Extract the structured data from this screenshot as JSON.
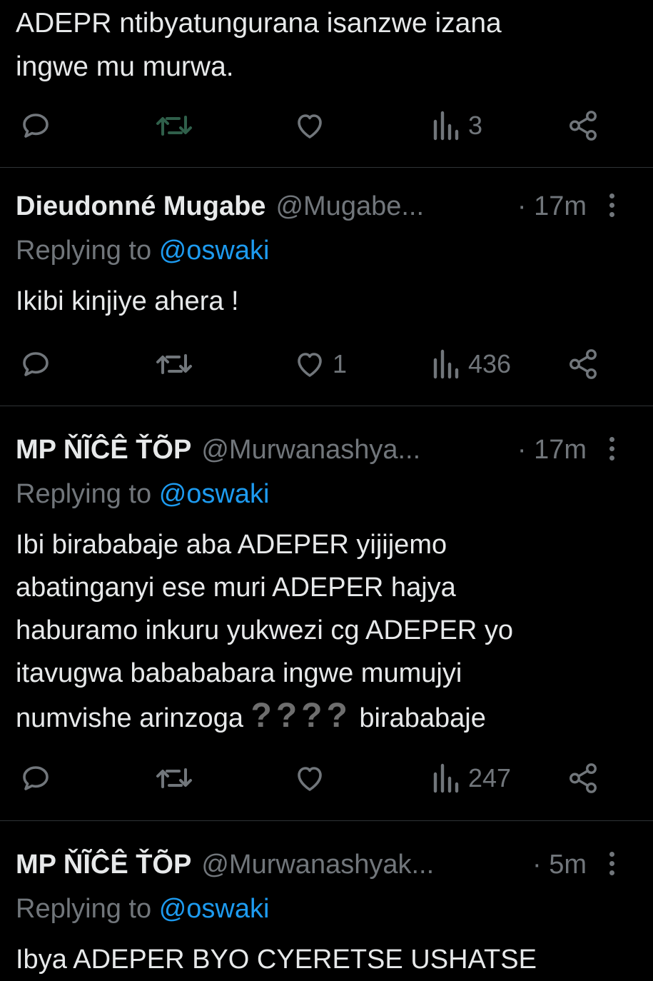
{
  "top_post": {
    "text_line1": "ADEPR ntibyatungurana isanzwe izana",
    "text_line2": "ingwe mu murwa.",
    "actions": {
      "reply": "",
      "retweet": "",
      "like": "",
      "views": "3"
    }
  },
  "posts": [
    {
      "name": "Dieudonné Mugabe",
      "handle": "@Mugabe...",
      "time": "· 17m",
      "replying_label": "Replying to",
      "replying_to": "@oswaki",
      "lines": [
        "Ikibi kinjiye ahera !"
      ],
      "actions": {
        "reply": "",
        "retweet": "",
        "like": "1",
        "views": "436"
      }
    },
    {
      "name": "MP ŇĨĈÊ ŤÕP",
      "handle": "@Murwanashya...",
      "time": "· 17m",
      "replying_label": "Replying to",
      "replying_to": "@oswaki",
      "lines": [
        "Ibi birababaje aba ADEPER yijijemo",
        "abatinganyi ese muri ADEPER hajya",
        "haburamo inkuru yukwezi cg ADEPER yo",
        "itavugwa babababara ingwe mumujyi"
      ],
      "last_line_start": "numvishe arinzoga",
      "last_line_marks": "????",
      "last_line_end": "birababaje",
      "actions": {
        "reply": "",
        "retweet": "",
        "like": "",
        "views": "247"
      }
    },
    {
      "name": "MP ŇĨĈÊ ŤÕP",
      "handle": "@Murwanashyak...",
      "time": "· 5m",
      "replying_label": "Replying to",
      "replying_to": "@oswaki",
      "lines": [
        "Ibya ADEPER BYO CYERETSE USHATSE"
      ]
    }
  ],
  "colors": {
    "background": "#000000",
    "text": "#e7e9ea",
    "muted": "#71767b",
    "link": "#1d9bf0",
    "divider": "#2f3336"
  }
}
